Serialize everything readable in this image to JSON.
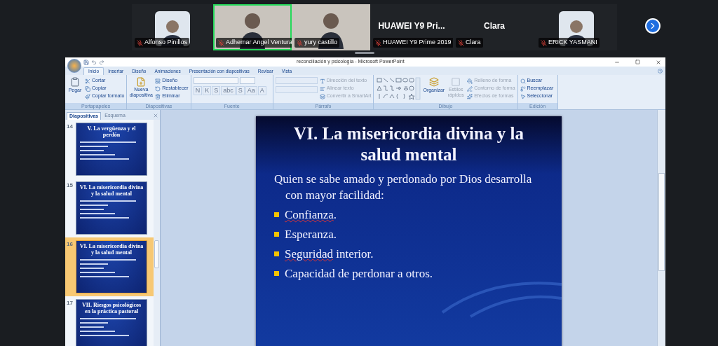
{
  "meeting": {
    "participants": [
      {
        "kind": "avatar",
        "name": "Alfonso Pinillos",
        "muted": true,
        "selected": false
      },
      {
        "kind": "video",
        "name": "Adhemar Angel Ventura",
        "muted": true,
        "selected": true
      },
      {
        "kind": "video",
        "name": "yury castillo",
        "muted": true,
        "selected": false
      },
      {
        "kind": "name",
        "tile_text": "HUAWEI Y9 Pri...",
        "name": "HUAWEI Y9 Prime 2019",
        "muted": true,
        "selected": false
      },
      {
        "kind": "name",
        "tile_text": "Clara",
        "name": "Clara",
        "muted": true,
        "selected": false
      },
      {
        "kind": "avatar",
        "name": "ERICK YASMANI",
        "muted": true,
        "selected": false
      }
    ]
  },
  "window": {
    "title": "reconciliación y psicología - Microsoft PowerPoint",
    "tabs": [
      {
        "label": "Inicio",
        "selected": true
      },
      {
        "label": "Insertar",
        "selected": false
      },
      {
        "label": "Diseño",
        "selected": false
      },
      {
        "label": "Animaciones",
        "selected": false
      },
      {
        "label": "Presentación con diapositivas",
        "selected": false
      },
      {
        "label": "Revisar",
        "selected": false
      },
      {
        "label": "Vista",
        "selected": false
      }
    ],
    "ribbon": [
      {
        "kind": "clipboard",
        "name": "Portapapeles",
        "large": "Pegar",
        "items": [
          "Cortar",
          "Copiar",
          "Copiar formato"
        ]
      },
      {
        "kind": "slides",
        "name": "Diapositivas",
        "large": "Nueva diapositiva",
        "items": [
          "Diseño",
          "Restablecer",
          "Eliminar"
        ]
      },
      {
        "kind": "font",
        "name": "Fuente",
        "buttons": [
          "N",
          "K",
          "S",
          "abc",
          "S",
          "Aa",
          "A"
        ]
      },
      {
        "kind": "paragraph",
        "name": "Párrafo",
        "items": [
          "Dirección del texto",
          "Alinear texto",
          "Convertir a SmartArt"
        ]
      },
      {
        "kind": "drawing",
        "name": "Dibujo",
        "large": "Organizar",
        "large2": "Estilos rápidos",
        "items": [
          "Relleno de forma",
          "Contorno de forma",
          "Efectos de formas"
        ]
      },
      {
        "kind": "editing",
        "name": "Edición",
        "items": [
          "Buscar",
          "Reemplazar",
          "Seleccionar"
        ]
      }
    ]
  },
  "pane": {
    "tabs": [
      {
        "label": "Diapositivas",
        "selected": true
      },
      {
        "label": "Esquema",
        "selected": false
      }
    ],
    "slides": [
      {
        "number": "14",
        "selected": false,
        "title": "V. La vergüenza y el perdón"
      },
      {
        "number": "15",
        "selected": false,
        "title": "VI. La misericordia divina y la salud mental"
      },
      {
        "number": "16",
        "selected": true,
        "title": "VI. La misericordia divina y la salud mental"
      },
      {
        "number": "17",
        "selected": false,
        "title": "VII. Riesgos psicológicos en la práctica pastoral"
      }
    ]
  },
  "slide": {
    "title": "VI. La misericordia divina y la salud mental",
    "intro": "Quien se sabe amado y perdonado por Dios desarrolla con mayor facilidad:",
    "bullets": [
      [
        {
          "text": "Confianza",
          "misspelled": true
        },
        {
          "text": ".",
          "misspelled": false
        }
      ],
      [
        {
          "text": "Esperanza.",
          "misspelled": false
        }
      ],
      [
        {
          "text": "Seguridad",
          "misspelled": true
        },
        {
          "text": " interior.",
          "misspelled": false
        }
      ],
      [
        {
          "text": "Capacidad de perdonar a otros.",
          "misspelled": false
        }
      ]
    ]
  }
}
